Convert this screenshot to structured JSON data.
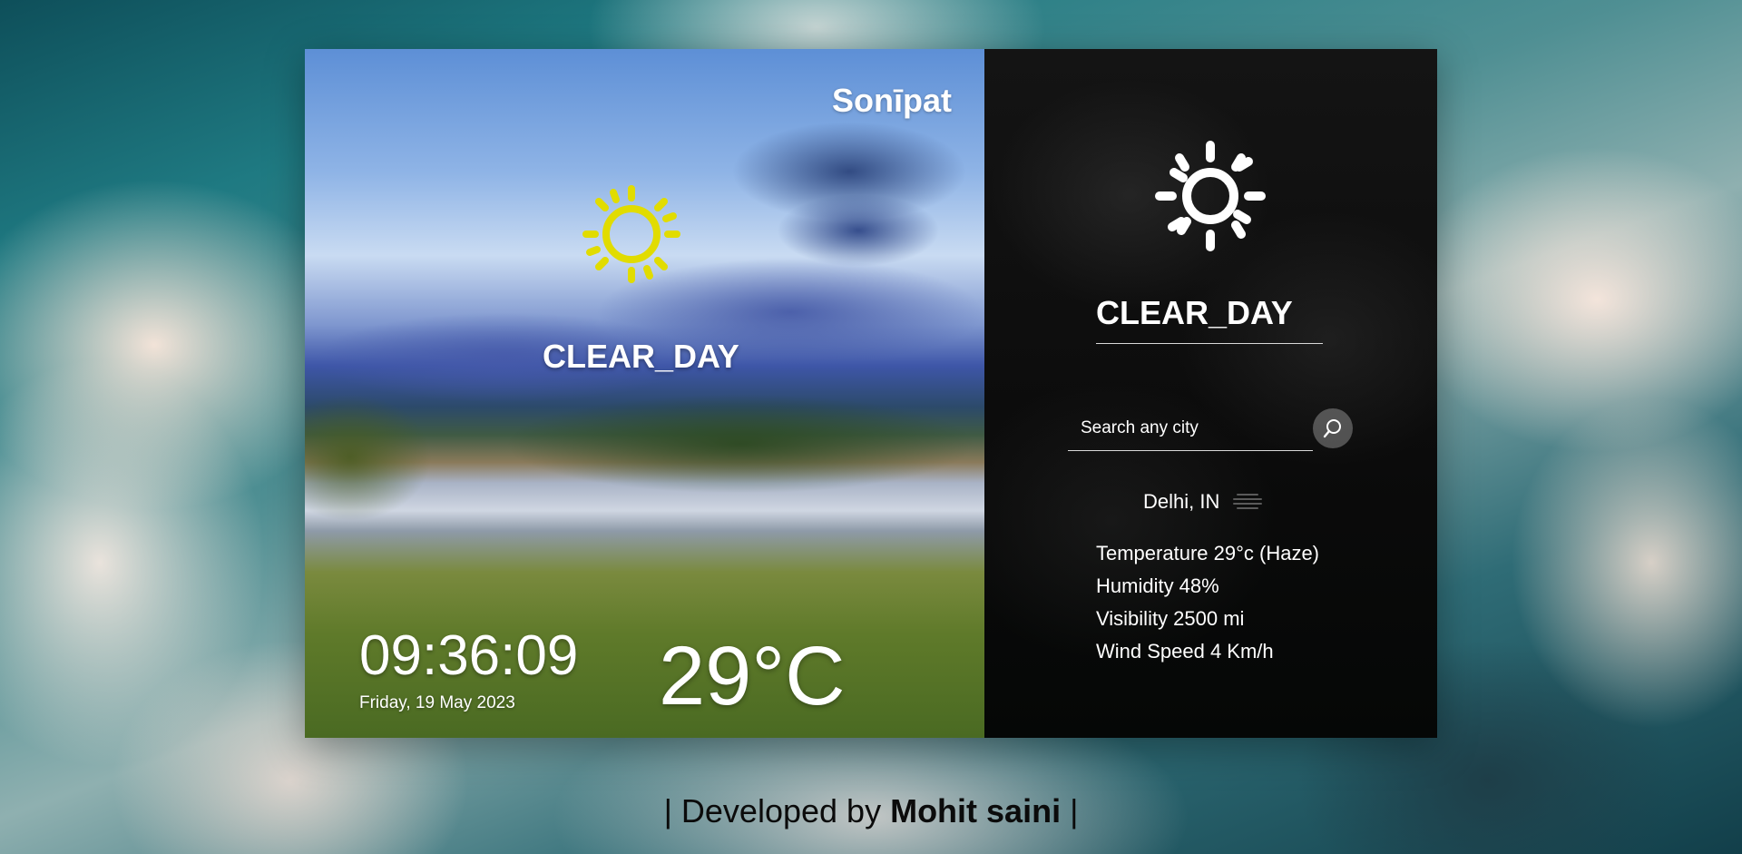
{
  "left_panel": {
    "city": "Sonīpat",
    "condition": "CLEAR_DAY",
    "weather_icon": "sun-icon",
    "icon_color": "#e1dc00",
    "time": "09:36:09",
    "date": "Friday, 19 May 2023",
    "temperature": "29°C"
  },
  "right_panel": {
    "weather_icon": "sun-icon",
    "icon_color": "#ffffff",
    "condition": "CLEAR_DAY",
    "search": {
      "placeholder": "Search any city",
      "value": "",
      "button_icon": "search-icon"
    },
    "location": "Delhi, IN",
    "location_icon": "haze-icon",
    "details": {
      "temperature": "Temperature 29°c (Haze)",
      "humidity": "Humidity 48%",
      "visibility": "Visibility 2500 mi",
      "wind_speed": "Wind Speed 4 Km/h"
    }
  },
  "footer": {
    "prefix": "| Developed by ",
    "author": "Mohit saini",
    "suffix": " |"
  }
}
